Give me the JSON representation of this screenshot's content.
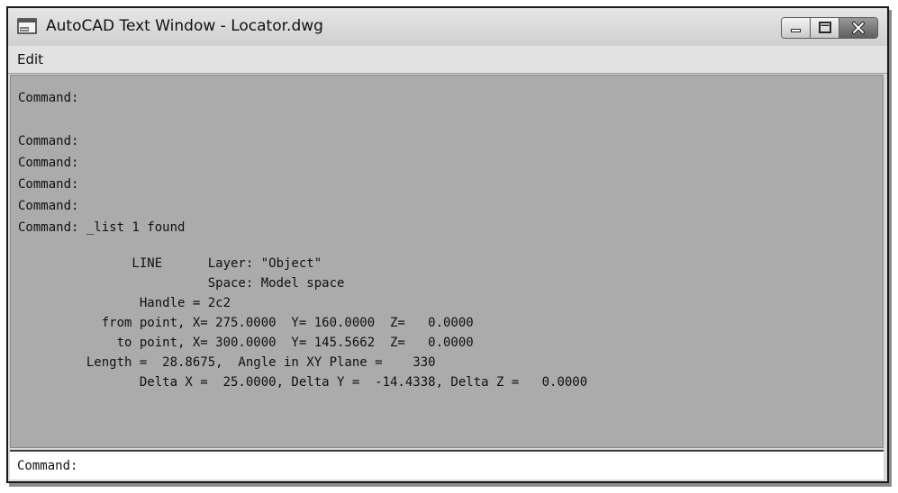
{
  "window": {
    "title": "AutoCAD Text Window - Locator.dwg",
    "icon": "text-window-icon",
    "controls": [
      "minimize-icon",
      "maximize-icon",
      "close-icon"
    ]
  },
  "menu": {
    "items": [
      {
        "label": "Edit"
      }
    ]
  },
  "history": [
    "Command:",
    "",
    "Command:",
    "Command:",
    "Command:",
    "Command:",
    "Command: _list 1 found",
    "",
    "               LINE      Layer: \"Object\"",
    "                         Space: Model space",
    "                Handle = 2c2",
    "           from point, X= 275.0000  Y= 160.0000  Z=   0.0000",
    "             to point, X= 300.0000  Y= 145.5662  Z=   0.0000",
    "         Length =  28.8675,  Angle in XY Plane =    330",
    "                Delta X =  25.0000, Delta Y =  -14.4338, Delta Z =   0.0000"
  ],
  "command_line": {
    "prompt": "Command:",
    "value": ""
  }
}
